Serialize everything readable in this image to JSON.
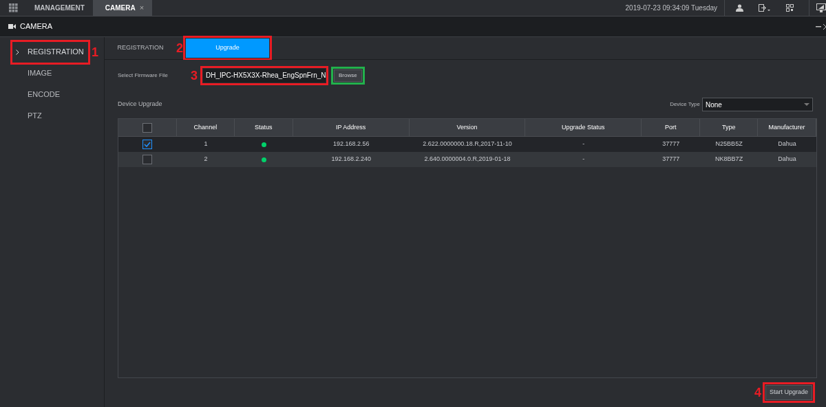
{
  "top_bar": {
    "tabs": [
      {
        "label": "MANAGEMENT",
        "kind": "home",
        "selected": false
      },
      {
        "label": "CAMERA",
        "kind": "camera",
        "selected": true,
        "close": "×"
      }
    ],
    "datetime": "2019-07-23 09:34:09 Tuesday"
  },
  "window": {
    "title": "CAMERA"
  },
  "sidebar": {
    "items": [
      {
        "label": "REGISTRATION",
        "selected": true,
        "callout": {
          "number": "1",
          "color": "#e81c24"
        }
      },
      {
        "label": "IMAGE",
        "selected": false
      },
      {
        "label": "ENCODE",
        "selected": false
      },
      {
        "label": "PTZ",
        "selected": false
      }
    ]
  },
  "tabs": [
    {
      "label": "REGISTRATION",
      "selected": false
    },
    {
      "label": "Upgrade",
      "selected": true,
      "callout": {
        "number": "2",
        "color": "#e81c24"
      }
    }
  ],
  "firmware": {
    "label": "Select Firmware File",
    "value": "DH_IPC-HX5X3X-Rhea_EngSpnFrn_N",
    "callout": {
      "number": "3",
      "color": "#e81c24"
    },
    "browse": {
      "label": "Browse",
      "callout": {
        "color": "#22b14c"
      }
    }
  },
  "device_upgrade": {
    "title": "Device Upgrade",
    "device_type": {
      "label": "Device Type",
      "value": "None"
    }
  },
  "table": {
    "header_checked": false,
    "columns": [
      "Channel",
      "Status",
      "IP Address",
      "Version",
      "Upgrade Status",
      "Port",
      "Type",
      "Manufacturer"
    ],
    "rows": [
      {
        "checked": true,
        "channel": "1",
        "color": "#00d26a",
        "ip": "192.168.2.56",
        "version": "2.622.0000000.18.R,2017-11-10",
        "upgrade_status": "-",
        "port": "37777",
        "type": "N25BB5Z",
        "manufacturer": "Dahua"
      },
      {
        "checked": false,
        "channel": "2",
        "color": "#00d26a",
        "ip": "192.168.2.240",
        "version": "2.640.0000004.0.R,2019-01-18",
        "upgrade_status": "-",
        "port": "37777",
        "type": "NK8BB7Z",
        "manufacturer": "Dahua"
      }
    ]
  },
  "start_button": {
    "label": "Start Upgrade",
    "callout": {
      "number": "4",
      "color": "#e81c24"
    }
  }
}
